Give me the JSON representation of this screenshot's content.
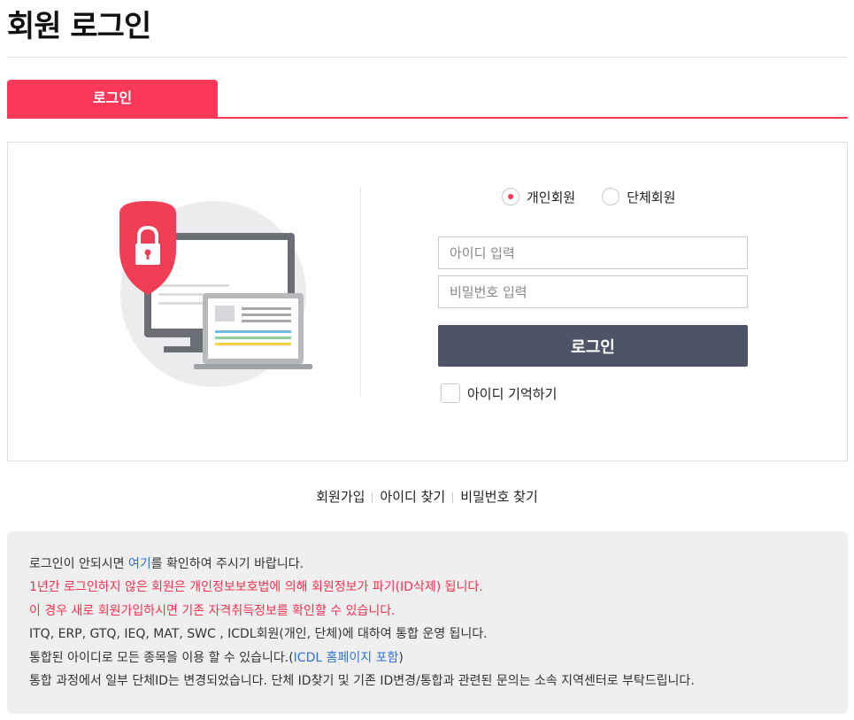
{
  "page": {
    "title": "회원 로그인"
  },
  "tabs": [
    {
      "label": "로그인",
      "active": true
    }
  ],
  "member_type": {
    "options": [
      {
        "label": "개인회원",
        "selected": true
      },
      {
        "label": "단체회원",
        "selected": false
      }
    ]
  },
  "form": {
    "id_placeholder": "아이디 입력",
    "id_value": "",
    "pw_placeholder": "비밀번호 입력",
    "pw_value": "",
    "login_button": "로그인",
    "remember_label": "아이디 기억하기",
    "remember_checked": false
  },
  "links": {
    "signup": "회원가입",
    "find_id": "아이디 찾기",
    "find_pw": "비밀번호 찾기"
  },
  "notice": {
    "line1_before": "로그인이 안되시면 ",
    "line1_link": "여기",
    "line1_after": "를 확인하여 주시기 바랍니다.",
    "line2": "1년간 로그인하지 않은 회원은 개인정보보호법에 의해 회원정보가 파기(ID삭제) 됩니다.",
    "line3": "이 경우 새로 회원가입하시면 기존 자격취득정보를 확인할 수 있습니다.",
    "line4": "ITQ, ERP, GTQ, IEQ, MAT, SWC , ICDL회원(개인, 단체)에 대하여 통합 운영 됩니다.",
    "line5_before": "통합된 아이디로 모든 종목을 이용 할 수 있습니다.(",
    "line5_link": "ICDL 홈페이지 포함",
    "line5_after": ")",
    "line6": "통합 과정에서 일부 단체ID는 변경되었습니다. 단체 ID찾기 및 기존 ID변경/통합과 관련된 문의는 소속 지역센터로 부탁드립니다."
  },
  "colors": {
    "accent": "#fb3859",
    "button": "#4d5467",
    "link": "#2f73d6",
    "warning_text": "#f0344f",
    "notice_bg": "#efefef"
  }
}
